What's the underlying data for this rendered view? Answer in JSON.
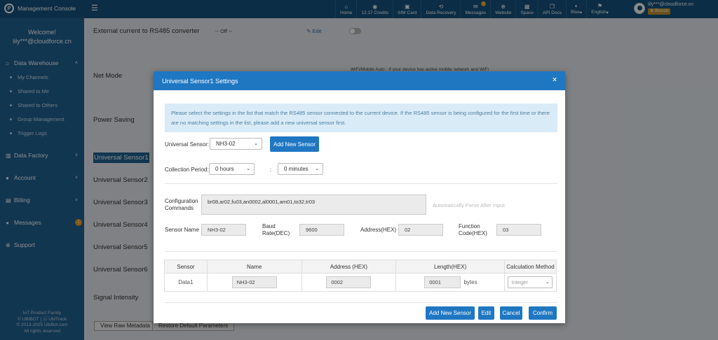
{
  "header": {
    "brand": "Management Console",
    "nav": [
      {
        "label": "Home",
        "icon": "home-icon",
        "glyph": "⌂"
      },
      {
        "label": "12.17 Credits",
        "icon": "credits-icon",
        "glyph": "◉"
      },
      {
        "label": "SIM Card",
        "icon": "sim-card-icon",
        "glyph": "▣"
      },
      {
        "label": "Data Recovery",
        "icon": "data-recovery-icon",
        "glyph": "⟲"
      },
      {
        "label": "Messages",
        "icon": "messages-icon",
        "glyph": "✉",
        "badge": "1"
      },
      {
        "label": "Website",
        "icon": "website-icon",
        "glyph": "⊕"
      },
      {
        "label": "Space",
        "icon": "space-icon",
        "glyph": "▦"
      },
      {
        "label": "API Docs",
        "icon": "api-docs-icon",
        "glyph": "❐"
      },
      {
        "label": "Blue",
        "icon": "theme-icon",
        "glyph": "◐",
        "dropdown": true
      },
      {
        "label": "English",
        "icon": "language-icon",
        "glyph": "⚑",
        "dropdown": true
      }
    ],
    "user": {
      "email": "lily***@cloudforce.cn",
      "level": "Bronze"
    }
  },
  "sidebar": {
    "welcome": "Welcome!",
    "user": "lily***@cloudforce.cn",
    "sections": [
      {
        "label": "Data Warehouse",
        "icon": "home-icon",
        "glyph": "⌂",
        "chevron": "˄"
      },
      {
        "label": "Data Factory",
        "icon": "factory-icon",
        "glyph": "▥",
        "chevron": "˅"
      },
      {
        "label": "Account",
        "icon": "user-icon",
        "glyph": "●",
        "chevron": "˅"
      },
      {
        "label": "Billing",
        "icon": "billing-icon",
        "glyph": "▤",
        "chevron": "˅"
      },
      {
        "label": "Messages",
        "icon": "megaphone-icon",
        "glyph": "◂",
        "count": "1"
      },
      {
        "label": "Support",
        "icon": "support-icon",
        "glyph": "⊕"
      }
    ],
    "warehouse_items": [
      "My Channels",
      "Shared to Me",
      "Shared to Others",
      "Group Management",
      "Trigger Logs"
    ],
    "footer": [
      "IoT Product Family",
      "© UBIBOT | ⓤ UbiTrack",
      "© 2013-2025 UbiBot.com",
      "All rights reserved"
    ]
  },
  "background": {
    "title_row": "External current to RS485 converter",
    "off_value": "-- Off --",
    "edit_label": "Edit",
    "net_mode": "Net Mode",
    "net_note": "WiFi/Mobile Auto : If your device has active mobile network and WiFi",
    "power_saving": "Power Saving",
    "sensors": [
      "Universal Sensor1",
      "Universal Sensor2",
      "Universal Sensor3",
      "Universal Sensor4",
      "Universal Sensor5",
      "Universal Sensor6"
    ],
    "signal": "Signal Intensity",
    "btn_raw": "View Raw Metadata",
    "btn_restore": "Restore Default Parameters"
  },
  "modal": {
    "title": "Universal Sensor1 Settings",
    "close": "×",
    "notice": "Please select the settings in the list that match the RS485 sensor connected to the current device. If the RS485 sensor is being configured for the first time or there are no matching settings in the list, please add a new universal sensor first.",
    "sensor_label": "Universal Sensor:",
    "sensor_value": "NH3-02",
    "add_new_sensor_top": "Add New Sensor",
    "period_label": "Collection Period:",
    "period_hours": "0  hours",
    "period_sep": ":",
    "period_minutes": "0  minutes",
    "config_label": "Configuration Commands",
    "config_value": "br08,ar02,fu03,an0002,al0001,am01,to32,tr03",
    "parse_hint": "Automatically Parse After Input",
    "sensor_name_label": "Sensor Name",
    "sensor_name": "NH3-02",
    "baud_label": "Baud Rate(DEC)",
    "baud": "9600",
    "address_label": "Address(HEX)",
    "address": "02",
    "function_label": "Function Code(HEX)",
    "function": "03",
    "table": {
      "headers": [
        "Sensor",
        "Name",
        "Address (HEX)",
        "Length(HEX)",
        "Calculation Method"
      ],
      "rows": [
        {
          "sensor": "Data1",
          "name": "NH3-02",
          "address": "0002",
          "length": "0001",
          "unit": "bytes",
          "method": "Integer"
        }
      ]
    },
    "footer": {
      "add": "Add New Sensor",
      "edit": "Edit",
      "cancel": "Cancel",
      "confirm": "Confirm"
    }
  }
}
